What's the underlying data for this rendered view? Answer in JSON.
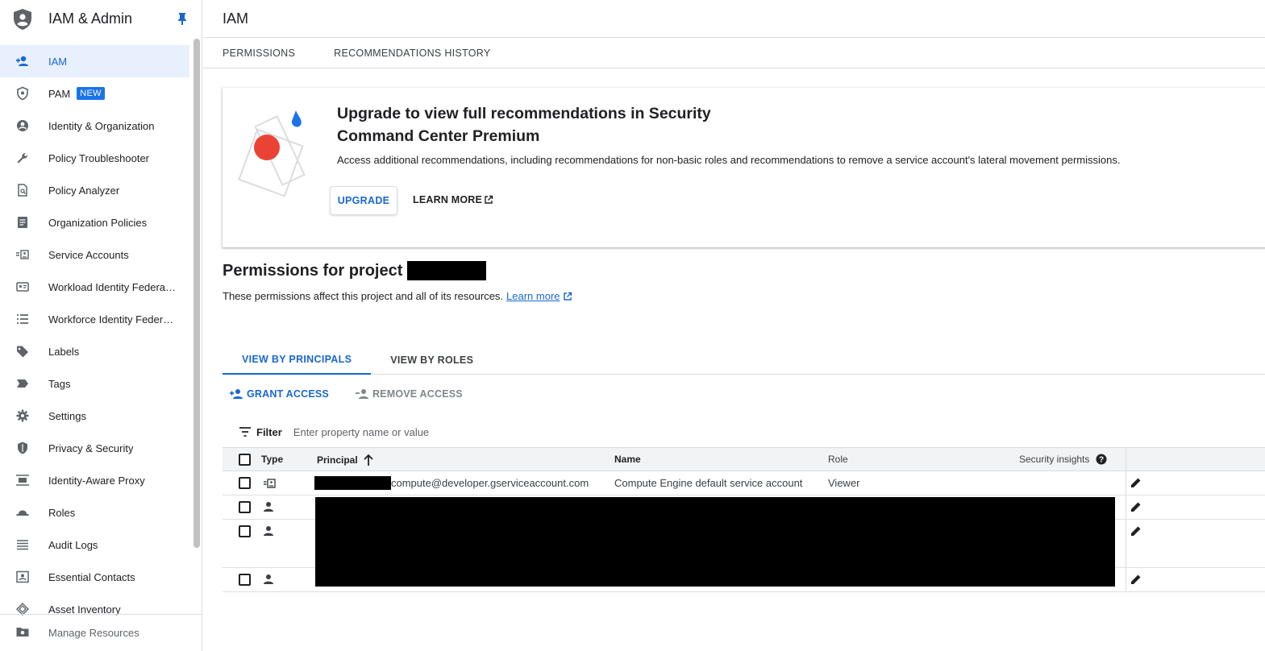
{
  "sidebar": {
    "title": "IAM & Admin",
    "items": [
      {
        "label": "IAM",
        "icon": "person-add-icon",
        "active": true
      },
      {
        "label": "PAM",
        "icon": "shield-lock-icon",
        "badge": "NEW"
      },
      {
        "label": "Identity & Organization",
        "icon": "account-circle-icon"
      },
      {
        "label": "Policy Troubleshooter",
        "icon": "wrench-icon"
      },
      {
        "label": "Policy Analyzer",
        "icon": "document-search-icon"
      },
      {
        "label": "Organization Policies",
        "icon": "list-doc-icon"
      },
      {
        "label": "Service Accounts",
        "icon": "service-account-icon"
      },
      {
        "label": "Workload Identity Federat…",
        "icon": "id-card-icon"
      },
      {
        "label": "Workforce Identity Federa…",
        "icon": "list-icon"
      },
      {
        "label": "Labels",
        "icon": "tag-icon"
      },
      {
        "label": "Tags",
        "icon": "label-arrow-icon"
      },
      {
        "label": "Settings",
        "icon": "gear-icon"
      },
      {
        "label": "Privacy & Security",
        "icon": "shield-icon"
      },
      {
        "label": "Identity-Aware Proxy",
        "icon": "proxy-icon"
      },
      {
        "label": "Roles",
        "icon": "hat-icon"
      },
      {
        "label": "Audit Logs",
        "icon": "lines-icon"
      },
      {
        "label": "Essential Contacts",
        "icon": "contact-card-icon"
      },
      {
        "label": "Asset Inventory",
        "icon": "diamond-layers-icon"
      }
    ],
    "footer": "Manage Resources"
  },
  "header": {
    "title": "IAM"
  },
  "page_tabs": [
    "PERMISSIONS",
    "RECOMMENDATIONS HISTORY"
  ],
  "promo": {
    "title": "Upgrade to view full recommendations in Security Command Center Premium",
    "description": "Access additional recommendations, including recommendations for non-basic roles and recommendations to remove a service account's lateral movement permissions.",
    "upgrade_label": "UPGRADE",
    "learn_more_label": "LEARN MORE"
  },
  "permissions": {
    "title": "Permissions for project",
    "description": "These permissions affect this project and all of its resources.",
    "learn_more": "Learn more"
  },
  "view_tabs": [
    {
      "label": "VIEW BY PRINCIPALS",
      "active": true
    },
    {
      "label": "VIEW BY ROLES",
      "active": false
    }
  ],
  "actions": {
    "grant": "GRANT ACCESS",
    "remove": "REMOVE ACCESS"
  },
  "filter": {
    "label": "Filter",
    "placeholder": "Enter property name or value"
  },
  "table": {
    "columns": {
      "type": "Type",
      "principal": "Principal",
      "name": "Name",
      "role": "Role",
      "insights": "Security insights"
    },
    "rows": [
      {
        "principal": "compute@developer.gserviceaccount.com",
        "name": "Compute Engine default service account",
        "role": "Viewer",
        "type_icon": "service-account-icon"
      },
      {
        "principal": "",
        "name": "",
        "role": "",
        "type_icon": "person-icon"
      },
      {
        "principal": "",
        "name": "",
        "role": "",
        "type_icon": "person-icon"
      },
      {
        "principal": "",
        "name": "",
        "role": "",
        "type_icon": "person-icon"
      }
    ]
  },
  "colors": {
    "accent": "#1967d2",
    "active_bg": "#e8f0fe",
    "badge": "#1a73e8",
    "promo_red": "#ea4335"
  }
}
